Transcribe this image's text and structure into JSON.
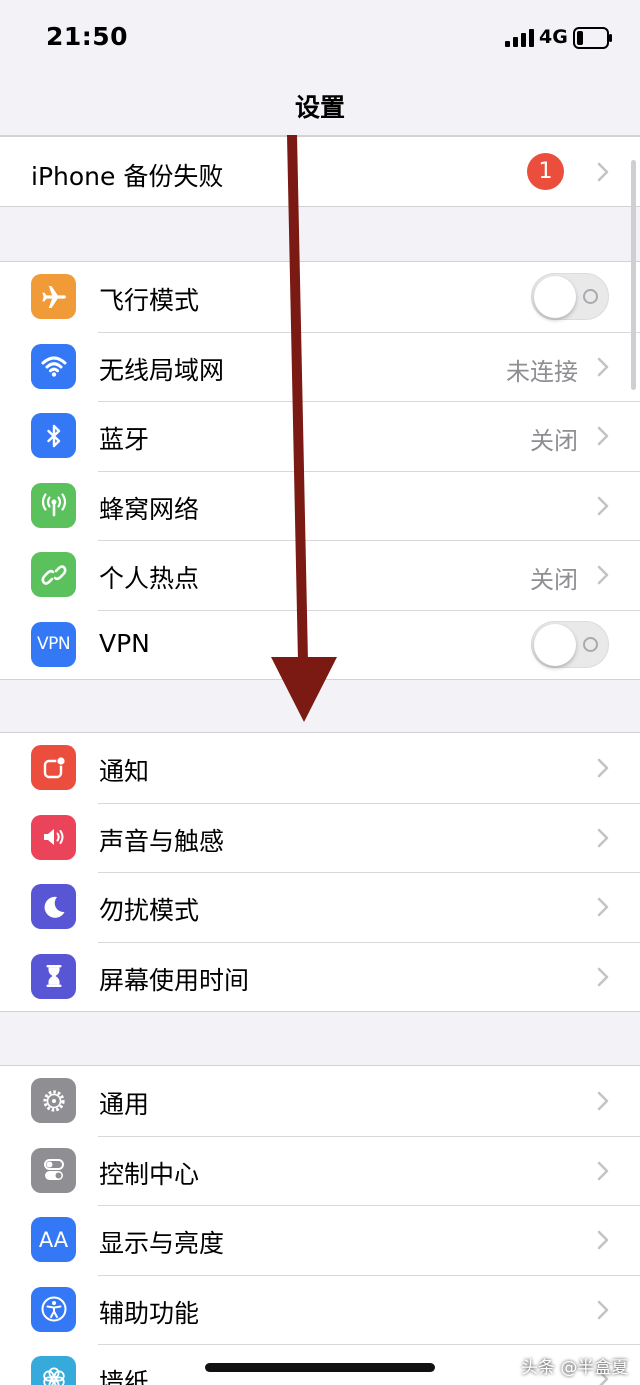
{
  "status": {
    "time": "21:50",
    "network": "4G"
  },
  "nav": {
    "title": "设置"
  },
  "backup": {
    "label": "iPhone 备份失败",
    "badge": "1"
  },
  "connectivity": [
    {
      "label": "飞行模式",
      "icon": "airplane-icon",
      "color": "#f19a38",
      "control": "toggle",
      "toggle_on": false
    },
    {
      "label": "无线局域网",
      "icon": "wifi-icon",
      "color": "#3478f6",
      "value": "未连接"
    },
    {
      "label": "蓝牙",
      "icon": "bluetooth-icon",
      "color": "#3478f6",
      "value": "关闭"
    },
    {
      "label": "蜂窝网络",
      "icon": "cellular-antenna-icon",
      "color": "#5ac15c"
    },
    {
      "label": "个人热点",
      "icon": "hotspot-chain-icon",
      "color": "#5ac15c",
      "value": "关闭"
    },
    {
      "label": "VPN",
      "icon": "vpn-icon",
      "icon_text": "VPN",
      "color": "#3478f6",
      "control": "toggle",
      "toggle_on": false
    }
  ],
  "notifications": [
    {
      "label": "通知",
      "icon": "notifications-icon",
      "color": "#eb4e3d"
    },
    {
      "label": "声音与触感",
      "icon": "speaker-icon",
      "color": "#eb445a"
    },
    {
      "label": "勿扰模式",
      "icon": "moon-icon",
      "color": "#5956d6"
    },
    {
      "label": "屏幕使用时间",
      "icon": "hourglass-icon",
      "color": "#5956d6"
    }
  ],
  "general": [
    {
      "label": "通用",
      "icon": "gear-icon",
      "color": "#8e8e93"
    },
    {
      "label": "控制中心",
      "icon": "toggles-icon",
      "color": "#8e8e93"
    },
    {
      "label": "显示与亮度",
      "icon": "text-size-icon",
      "icon_text": "AA",
      "color": "#3478f6"
    },
    {
      "label": "辅助功能",
      "icon": "accessibility-icon",
      "color": "#3478f6"
    },
    {
      "label": "墙纸",
      "icon": "flower-icon",
      "color": "#37aadc"
    }
  ],
  "watermark": "头条 @半盒夏",
  "colors": {
    "annotation_arrow": "#7a1a12"
  }
}
